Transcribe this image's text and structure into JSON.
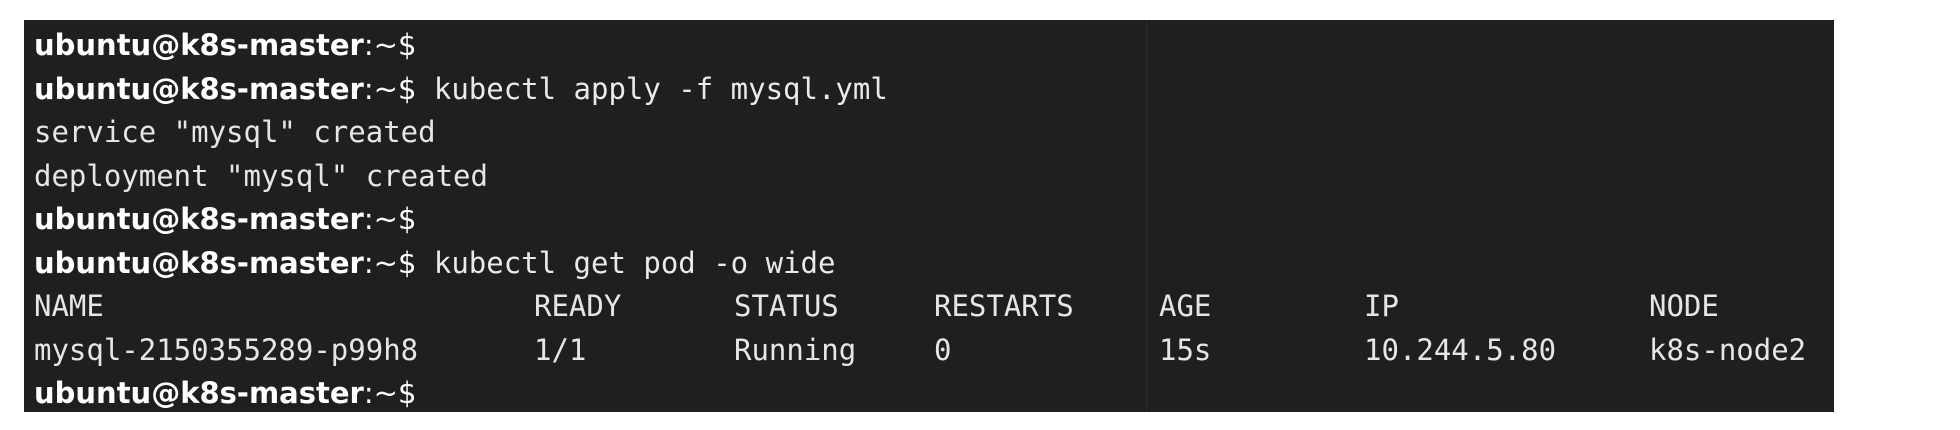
{
  "terminal": {
    "prompt": {
      "user_host": "ubuntu@k8s-master",
      "path": ":~",
      "symbol": "$"
    },
    "lines": [
      {
        "type": "prompt",
        "command": ""
      },
      {
        "type": "prompt",
        "command": "kubectl apply -f mysql.yml"
      },
      {
        "type": "output",
        "text": "service \"mysql\" created"
      },
      {
        "type": "output",
        "text": "deployment \"mysql\" created"
      },
      {
        "type": "prompt",
        "command": ""
      },
      {
        "type": "prompt",
        "command": "kubectl get pod -o wide"
      },
      {
        "type": "table_header"
      },
      {
        "type": "table_row"
      },
      {
        "type": "prompt",
        "command": ""
      }
    ],
    "table": {
      "headers": [
        "NAME",
        "READY",
        "STATUS",
        "RESTARTS",
        "AGE",
        "IP",
        "NODE"
      ],
      "rows": [
        [
          "mysql-2150355289-p99h8",
          "1/1",
          "Running",
          "0",
          "15s",
          "10.244.5.80",
          "k8s-node2"
        ]
      ]
    }
  }
}
